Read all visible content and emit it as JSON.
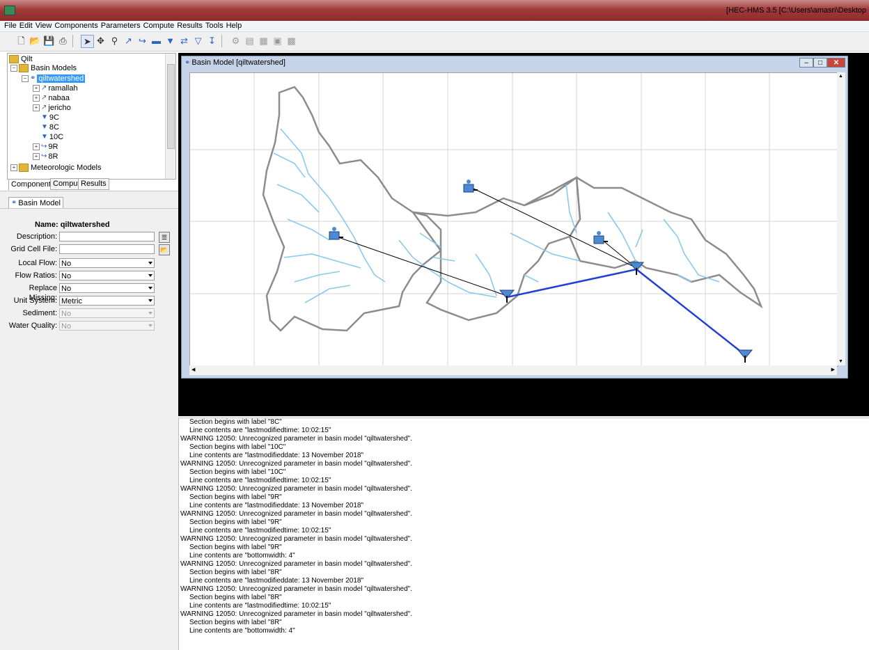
{
  "window": {
    "title": "[HEC-HMS 3.5 [C:\\Users\\amasri\\Desktop"
  },
  "menu": [
    "File",
    "Edit",
    "View",
    "Components",
    "Parameters",
    "Compute",
    "Results",
    "Tools",
    "Help"
  ],
  "toolbar": {
    "icons": [
      "new-file-icon",
      "open-folder-icon",
      "save-icon",
      "print-icon",
      "arrow-select-icon",
      "pan-icon",
      "zoom-icon",
      "subbasin-tool-icon",
      "reach-tool-icon",
      "reservoir-tool-icon",
      "junction-tool-icon",
      "diversion-tool-icon",
      "source-tool-icon",
      "sink-tool-icon",
      "compute-icon",
      "results-graph-icon",
      "results-summary-icon",
      "results-table-icon",
      "results-global-icon"
    ]
  },
  "tree": {
    "root": "Qilt",
    "basin_models_label": "Basin Models",
    "selected_model": "qiltwatershed",
    "elements": [
      "ramallah",
      "nabaa",
      "jericho",
      "9C",
      "8C",
      "10C",
      "9R",
      "8R"
    ],
    "meteorologic_label": "Meteorologic Models"
  },
  "left_tabs": [
    "Components",
    "Compute",
    "Results"
  ],
  "properties": {
    "tab": "Basin Model",
    "name_label": "Name:",
    "name_value": "qiltwatershed",
    "fields": [
      {
        "label": "Description:",
        "value": "",
        "enabled": true
      },
      {
        "label": "Grid Cell File:",
        "value": "",
        "enabled": true
      },
      {
        "label": "Local Flow:",
        "value": "No",
        "enabled": true
      },
      {
        "label": "Flow Ratios:",
        "value": "No",
        "enabled": true
      },
      {
        "label": "Replace Missing:",
        "value": "No",
        "enabled": true
      },
      {
        "label": "Unit System:",
        "value": "Metric",
        "enabled": true
      },
      {
        "label": "Sediment:",
        "value": "No",
        "enabled": false
      },
      {
        "label": "Water Quality:",
        "value": "No",
        "enabled": false
      }
    ]
  },
  "basin_window": {
    "title": "Basin Model [qiltwatershed]"
  },
  "log": [
    {
      "t": "Section begins with label \"8C\"",
      "indent": true
    },
    {
      "t": "Line contents are \"lastmodifiedtime: 10:02:15\"",
      "indent": true
    },
    {
      "t": "WARNING 12050:  Unrecognized parameter in basin model \"qiltwatershed\".",
      "indent": false
    },
    {
      "t": "Section begins with label \"10C\"",
      "indent": true
    },
    {
      "t": "Line contents are \"lastmodifieddate: 13 November 2018\"",
      "indent": true
    },
    {
      "t": "WARNING 12050:  Unrecognized parameter in basin model \"qiltwatershed\".",
      "indent": false
    },
    {
      "t": "Section begins with label \"10C\"",
      "indent": true
    },
    {
      "t": "Line contents are \"lastmodifiedtime: 10:02:15\"",
      "indent": true
    },
    {
      "t": "WARNING 12050:  Unrecognized parameter in basin model \"qiltwatershed\".",
      "indent": false
    },
    {
      "t": "Section begins with label \"9R\"",
      "indent": true
    },
    {
      "t": "Line contents are \"lastmodifieddate: 13 November 2018\"",
      "indent": true
    },
    {
      "t": "WARNING 12050:  Unrecognized parameter in basin model \"qiltwatershed\".",
      "indent": false
    },
    {
      "t": "Section begins with label \"9R\"",
      "indent": true
    },
    {
      "t": "Line contents are \"lastmodifiedtime: 10:02:15\"",
      "indent": true
    },
    {
      "t": "WARNING 12050:  Unrecognized parameter in basin model \"qiltwatershed\".",
      "indent": false
    },
    {
      "t": "Section begins with label \"9R\"",
      "indent": true
    },
    {
      "t": "Line contents are \"bottomwidth: 4\"",
      "indent": true
    },
    {
      "t": "WARNING 12050:  Unrecognized parameter in basin model \"qiltwatershed\".",
      "indent": false
    },
    {
      "t": "Section begins with label \"8R\"",
      "indent": true
    },
    {
      "t": "Line contents are \"lastmodifieddate: 13 November 2018\"",
      "indent": true
    },
    {
      "t": "WARNING 12050:  Unrecognized parameter in basin model \"qiltwatershed\".",
      "indent": false
    },
    {
      "t": "Section begins with label \"8R\"",
      "indent": true
    },
    {
      "t": "Line contents are \"lastmodifiedtime: 10:02:15\"",
      "indent": true
    },
    {
      "t": "WARNING 12050:  Unrecognized parameter in basin model \"qiltwatershed\".",
      "indent": false
    },
    {
      "t": "Section begins with label \"8R\"",
      "indent": true
    },
    {
      "t": "Line contents are \"bottomwidth: 4\"",
      "indent": true
    }
  ]
}
